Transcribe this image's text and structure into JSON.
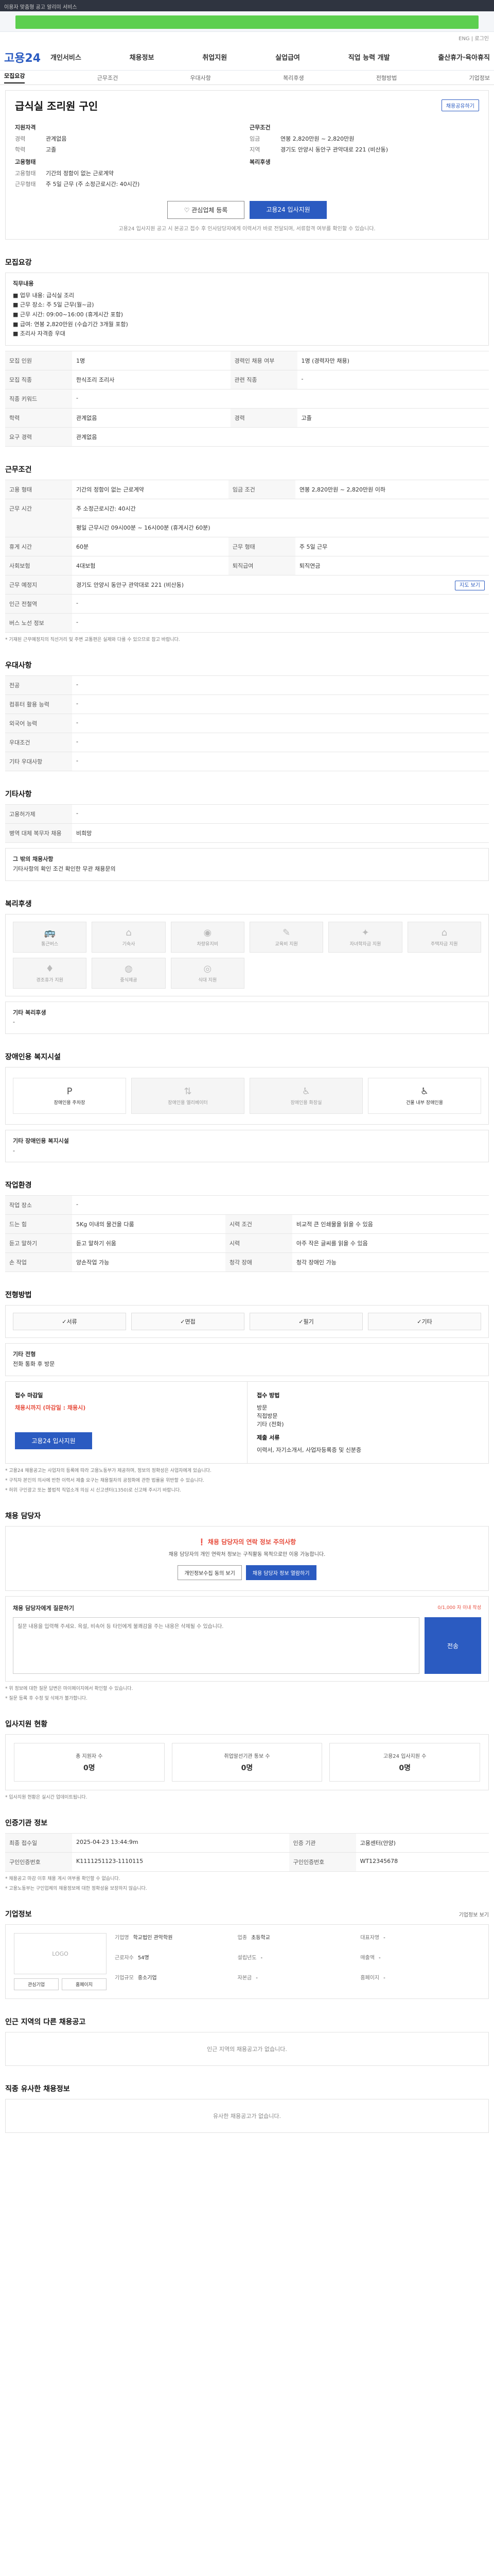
{
  "topbar": {
    "text": "이용자 맞춤형 공고 알리미 서비스"
  },
  "accent": {
    "right_text": "ENG  |  로그인"
  },
  "brand": {
    "logo": "고용24"
  },
  "nav": [
    "개인서비스",
    "채용정보",
    "취업지원",
    "실업급여",
    "직업 능력 개발",
    "출산휴가·육아휴직"
  ],
  "tabs": [
    "모집요강",
    "근무조건",
    "우대사항",
    "복리후생",
    "전형방법",
    "기업정보"
  ],
  "job": {
    "title": "급식실 조리원 구인",
    "share_label": "채용공유하기",
    "apply_label": "지원자격",
    "cond_label": "근무조건",
    "experience_k": "경력",
    "experience_v": "관계없음",
    "education_k": "학력",
    "education_v": "고졸",
    "wage_k": "임금",
    "wage_v": "연봉 2,820만원 ~ 2,820만원",
    "location_k": "지역",
    "location_v": "경기도 안양시 동안구 관악대로 221 (비산동)",
    "employ_label": "고용형태",
    "employ_type_k": "고용형태",
    "employ_type_v": "기간의 정함이 없는 근로계약",
    "work_time_k": "근무형태",
    "work_time_v": "주 5일 근무 (주 소정근로시간: 40시간)",
    "benefit_label": "복리후생",
    "btn_interest": "관심업체 등록",
    "btn_apply": "고용24 입사지원",
    "notice": "고용24 입사지원 공고 시 본공고 접수 후 인사담당자에게 이력서가 바로 전달되며, 서류합격 여부를 확인할 수 있습니다."
  },
  "recruit": {
    "title": "모집요강",
    "duty_title": "직무내용",
    "duties": [
      "■ 업무 내용: 급식실 조리",
      "■ 근무 장소: 주 5일 근무(월~금)",
      "■ 근무 시간: 09:00~16:00 (휴게시간 포함)",
      "■ 급여: 연봉 2,820만원 (수습기간 3개월 포함)",
      "■ 조리사 자격증 우대"
    ],
    "rows": [
      [
        "모집 인원",
        "1명",
        "경력인 채용 여부",
        "1명 (경력자만 채용)"
      ],
      [
        "모집 직종",
        "한식조리 조리사",
        "관련 직종",
        "-"
      ],
      [
        "직종 키워드",
        "-",
        "",
        ""
      ],
      [
        "학력",
        "관계없음",
        "경력",
        "고졸"
      ],
      [
        "요구 경력",
        "관계없음",
        "",
        ""
      ]
    ]
  },
  "conditions": {
    "title": "근무조건",
    "rows": [
      [
        "고용 형태",
        "기간의 정함이 없는 근로계약",
        "임금 조건",
        "연봉 2,820만원 ~ 2,820만원 이하"
      ],
      [
        "근무 시간",
        "주 소정근로시간: 40시간",
        "",
        ""
      ],
      [
        "",
        "평일 근무시간 09시00분 ~ 16시00분 (휴게시간 60분)",
        "",
        ""
      ],
      [
        "휴게 시간",
        "60분",
        "근무 형태",
        "주 5일 근무"
      ],
      [
        "사회보험",
        "4대보험",
        "퇴직급여",
        "퇴직연금"
      ],
      [
        "근무 예정지",
        "경기도 안양시 동안구 관악대로 221 (비산동)",
        "",
        ""
      ],
      [
        "인근 전철역",
        "-",
        "",
        ""
      ],
      [
        "버스 노선 정보",
        "-",
        "",
        ""
      ]
    ],
    "map_btn": "지도 보기",
    "footnote": "* 기재된 근무예정지의 직선거리 및 주변 교통편은 실제와 다를 수 있으므로 참고 바랍니다."
  },
  "preference": {
    "title": "우대사항",
    "rows": [
      [
        "전공",
        "-"
      ],
      [
        "컴퓨터 활용 능력",
        "-"
      ],
      [
        "외국어 능력",
        "-"
      ],
      [
        "우대조건",
        "-"
      ],
      [
        "기타 우대사항",
        "-"
      ]
    ]
  },
  "other": {
    "title": "기타사항",
    "rows": [
      [
        "고용허가제",
        "-"
      ],
      [
        "병역 대체 복무자 채용",
        "비희망"
      ]
    ],
    "note_title": "그 밖의 채용사항",
    "note_text": "기타사항의 확인 조건 확인한 무관 채용문의"
  },
  "benefits": {
    "title": "복리후생",
    "items": [
      "통근버스",
      "기숙사",
      "차량유지비",
      "교육비 지원",
      "자녀학자금 지원",
      "주택자금 지원",
      "경조휴가 지원",
      "중식제공",
      "식대 지원",
      "",
      "",
      ""
    ],
    "other_title": "기타 복리후생",
    "other_value": "-"
  },
  "disability": {
    "title": "장애인용 복지시설",
    "items": [
      "장애인용 주차장",
      "장애인용 엘리베이터",
      "장애인용 화장실",
      "건물 내부 장애인용"
    ],
    "other_title": "기타 장애인용 복지시설",
    "other_value": "-"
  },
  "workenv": {
    "title": "작업환경",
    "rows": [
      [
        "작업 장소",
        "-",
        "",
        ""
      ],
      [
        "드는 힘",
        "5Kg 이내의 물건을 다룸",
        "시력 조건",
        "비교적 큰 인쇄물을 읽을 수 있음"
      ],
      [
        "듣고 말하기",
        "듣고 말하기 쉬움",
        "시력",
        "아주 작은 글씨를 읽을 수 있음"
      ],
      [
        "손 작업",
        "양손작업 가능",
        "청각 장애",
        "청각 장애인 가능"
      ]
    ]
  },
  "selection": {
    "title": "전형방법",
    "methods": [
      "서류",
      "면접",
      "필기",
      "기타"
    ],
    "etc_title": "기타 전형",
    "etc_text": "전화 통화 후 방문",
    "period_title": "접수 마감일",
    "period_value": "채용시까지 (마감일 : 채용시)",
    "method_title": "접수 방법",
    "methods_applied": [
      "방문",
      "직접방문",
      "기타 (전화)"
    ],
    "doc_title": "제출 서류",
    "doc_text": "이력서, 자기소개서, 사업자등록증 및 신분증",
    "apply_btn": "고용24 입사지원",
    "warn_lines": [
      "* 고용24 채용공고는 사업자의 등록에 따라 고용노동부가 제공하며, 정보의 정확성은 사업자에게 있습니다.",
      "* 구직자 본인의 의사에 반한 이력서 제출 요구는 채용절차의 공정화에 관한 법률을 위반할 수 있습니다.",
      "* 허위 구인광고 또는 불법적 직업소개 의심 시 신고센터(1350)로 신고해 주시기 바랍니다."
    ]
  },
  "contact": {
    "title": "채용 담당자",
    "warn_main": "채용 담당자의 연락 정보 주의사항",
    "warn_sub": "채용 담당자의 개인 연락처 정보는 구직활동 목적으로만 이용 가능합니다.",
    "btn_info": "개인정보수집 동의 보기",
    "btn_view": "채용 담당자 정보 열람하기",
    "inquiry_title": "채용 담당자에게 질문하기",
    "inquiry_hint": "0/1,000 자 이내 작성",
    "inquiry_placeholder": "질문 내용을 입력해 주세요. 욕설, 비속어 등 타인에게 불쾌감을 주는 내용은 삭제될 수 있습니다.",
    "send_btn": "전송",
    "notes": [
      "* 위 정보에 대한 질문 답변은 마이페이지에서 확인할 수 있습니다.",
      "* 질문 등록 후 수정 및 삭제가 불가합니다."
    ]
  },
  "stats": {
    "title": "입사지원 현황",
    "items": [
      {
        "label": "총 지원자 수",
        "value": "0명"
      },
      {
        "label": "취업알선기관 통보 수",
        "value": "0명"
      },
      {
        "label": "고용24 입사지원 수",
        "value": "0명"
      }
    ],
    "note": "* 입사지원 현황은 실시간 업데이트됩니다."
  },
  "register": {
    "title": "인증기관 정보",
    "rows": [
      [
        "최종 접수일",
        "2025-04-23 13:44:9m",
        "인증 기관",
        "고용센터(안양)",
        "등록일",
        "2025-04-23"
      ],
      [
        "구인인증번호",
        "K1111251123-1110115",
        "구인인증번호",
        "WT12345678"
      ]
    ],
    "notes": [
      "* 채용공고 마감 이후 채용 게시 여부를 확인할 수 없습니다.",
      "* 고용노동부는 구인업체의 채용정보에 대한 정확성을 보장하지 않습니다."
    ]
  },
  "company": {
    "title": "기업정보",
    "logo": "LOGO",
    "logo_btns": [
      "관심기업",
      "홈페이지"
    ],
    "fields": [
      [
        "기업명",
        "학교법인 관악학원"
      ],
      [
        "업종",
        "초등학교"
      ],
      [
        "대표자명",
        "-"
      ],
      [
        "근로자수",
        "54명"
      ],
      [
        "설립년도",
        "-"
      ],
      [
        "매출액",
        "-"
      ],
      [
        "기업규모",
        "중소기업"
      ],
      [
        "자본금",
        "-"
      ],
      [
        "홈페이지",
        "-"
      ]
    ],
    "more_btn": "기업정보 보기"
  },
  "related": {
    "title": "인근 지역의 다른 채용공고",
    "empty": "인근 지역의 채용공고가 없습니다."
  },
  "similar": {
    "title": "직종 유사한 채용정보",
    "empty": "유사한 채용공고가 없습니다."
  }
}
